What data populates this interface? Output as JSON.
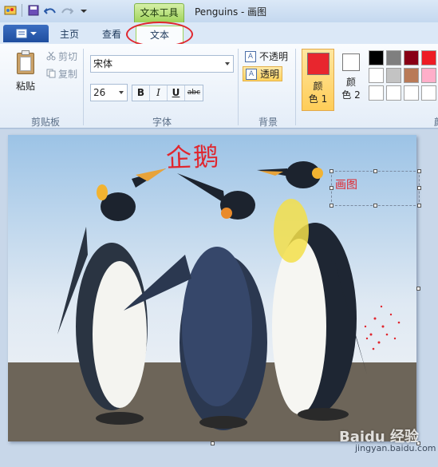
{
  "window": {
    "context_tab_label": "文本工具",
    "title": "Penguins - 画图"
  },
  "tabs": {
    "file_icon": "file-menu-icon",
    "home": "主页",
    "view": "查看",
    "text": "文本"
  },
  "clipboard": {
    "paste": "粘贴",
    "cut": "剪切",
    "copy": "复制",
    "group_label": "剪贴板"
  },
  "font": {
    "family": "宋体",
    "size": "26",
    "bold": "B",
    "italic": "I",
    "underline": "U",
    "strike": "abc",
    "group_label": "字体"
  },
  "background": {
    "opaque": "不透明",
    "transparent": "透明",
    "selected": "透明",
    "group_label": "背景"
  },
  "colors": {
    "color1_label_line1": "颜",
    "color1_label_line2": "色 1",
    "color1_value": "#e8262e",
    "color2_label_line1": "颜",
    "color2_label_line2": "色 2",
    "color2_value": "#ffffff",
    "group_label_partial": "颜",
    "palette": [
      "#000000",
      "#7f7f7f",
      "#880015",
      "#ed1c24",
      "#ffffff",
      "#ffffff",
      "#c3c3c3",
      "#b97a57",
      "#ffaec9",
      "#ffffff",
      "#ffffff",
      "#ffffff",
      "#ffffff",
      "#ffffff",
      "#ffffff"
    ]
  },
  "canvas": {
    "handwritten_title": "企鹅",
    "text_box_content": "画图"
  },
  "watermark": {
    "main": "Baidu 经验",
    "sub": "jingyan.baidu.com"
  }
}
